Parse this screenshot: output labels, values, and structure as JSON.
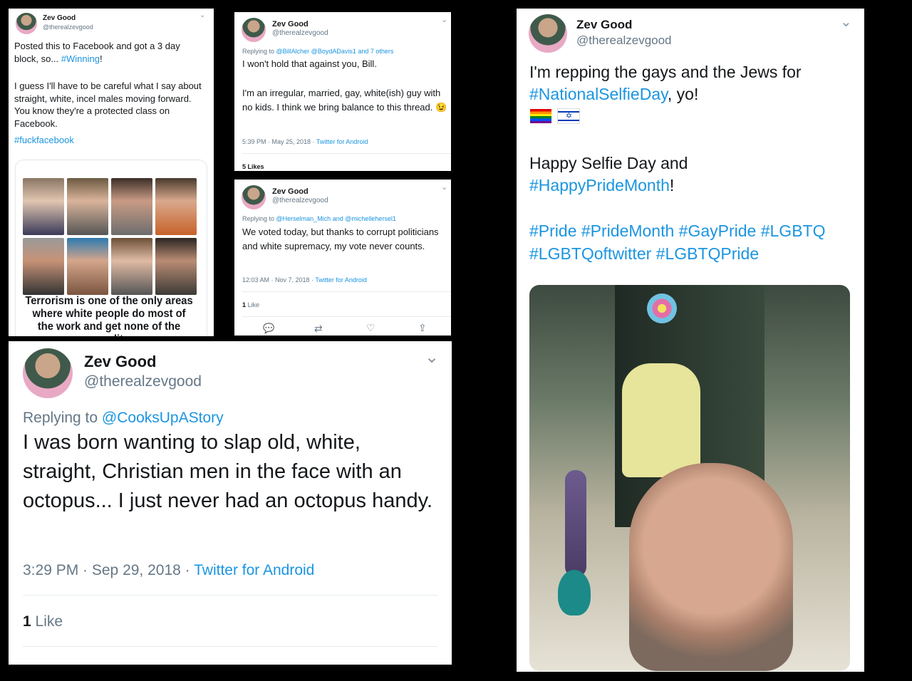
{
  "tweet1": {
    "name": "Zev Good",
    "handle": "@therealzevgood",
    "line1": "Posted this to Facebook and got a 3 day block, so... ",
    "line1_tag": "#Winning",
    "line1_end": "!",
    "body": "I guess I'll have to be careful what I say about straight, white, incel males moving forward. You know they're a protected class on Facebook.",
    "tag": "#fuckfacebook",
    "meme_caption": "Terrorism is one of the only areas where white people do most of the work and get none of the credit"
  },
  "tweet2": {
    "name": "Zev Good",
    "handle": "@therealzevgood",
    "replying_prefix": "Replying to ",
    "replying_to": "@BillAlcher @BoydADavis1 and 7 others",
    "line1": "I won't hold that against you, Bill.",
    "body": "I'm an irregular, married, gay, white(ish) guy with no kids. I think we bring balance to this thread. 😉",
    "timestamp": "5:39 PM · May 25, 2018 · ",
    "client": "Twitter for Android",
    "likes_partial": "5 Likes"
  },
  "tweet3": {
    "name": "Zev Good",
    "handle": "@therealzevgood",
    "replying_prefix": "Replying to ",
    "replying_to": "@Herselman_Mich and @michellehersel1",
    "body": "We voted today, but thanks to corrupt politicians and white supremacy, my vote never counts.",
    "timestamp": "12:03 AM · Nov 7, 2018 · ",
    "client": "Twitter for Android",
    "likes_count": "1",
    "likes_label": "Like"
  },
  "tweet4": {
    "name": "Zev Good",
    "handle": "@therealzevgood",
    "replying_prefix": "Replying to ",
    "replying_to": "@CooksUpAStory",
    "body": "I was born wanting to slap old, white, straight, Christian men in the face with an octopus... I just never had an octopus handy.",
    "timestamp": "3:29 PM · Sep 29, 2018 · ",
    "client": "Twitter for Android",
    "likes_count": "1",
    "likes_label": "Like"
  },
  "tweet5": {
    "name": "Zev Good",
    "handle": "@therealzevgood",
    "line1": "I'm repping the gays and the Jews for",
    "line2_tag": "#NationalSelfieDay",
    "line2_end": ", yo!",
    "line3": "Happy Selfie Day and",
    "line4_tag": "#HappyPrideMonth",
    "line4_end": "!",
    "tags_line1": "#Pride #PrideMonth #GayPride #LGBTQ",
    "tags_line2": "#LGBTQoftwitter #LGBTQPride"
  },
  "icons": {
    "chevron": "chevron-down-icon",
    "reply": "reply-icon",
    "retweet": "retweet-icon",
    "like": "heart-icon",
    "share": "share-icon"
  },
  "colors": {
    "link": "#1b95e0",
    "muted": "#657786",
    "background": "#000000"
  }
}
